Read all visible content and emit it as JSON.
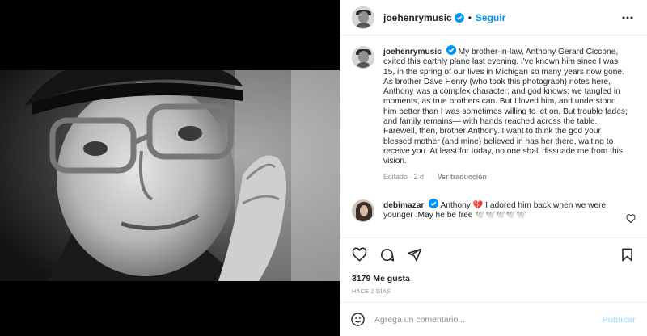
{
  "post": {
    "username": "joehenrymusic",
    "separator": "•",
    "follow_label": "Seguir",
    "caption": "My brother-in-law, Anthony Gerard Ciccone, exited this earthly plane last evening. I've known him since I was 15, in the spring of our lives in Michigan so many years now gone. As brother Dave Henry (who took this photograph) notes here, Anthony was a complex character; and god knows: we tangled in moments, as true brothers can. But I loved him, and understood him better than I was sometimes willing to let on. But trouble fades; and family remains— with hands reached across the table. Farewell, then, brother Anthony. I want to think the god your blessed mother (and mine) believed in has her there, waiting to receive you. At least for today, no one shall dissuade me from this vision.",
    "edited_label": "Editado · 2 d",
    "translate_label": "Ver traducción",
    "likes_label": "3179 Me gusta",
    "time_ago": "HACE 2 DÍAS"
  },
  "comments": [
    {
      "username": "debimazar",
      "text": "Anthony 💔 I adored him back when we were younger .May he be free 🕊️🕊️🕊️🕊️🕊️"
    }
  ],
  "composer": {
    "placeholder": "Agrega un comentario...",
    "publish_label": "Publicar"
  },
  "icons": {
    "more": "more-horizontal-icon",
    "like": "heart-icon",
    "comment": "comment-icon",
    "share": "share-icon",
    "save": "bookmark-icon",
    "emoji": "emoji-icon",
    "verified": "verified-badge-icon"
  },
  "colors": {
    "accent": "#0095f6",
    "publish_disabled": "#b2dffc",
    "muted": "#8e8e8e",
    "text": "#262626"
  }
}
